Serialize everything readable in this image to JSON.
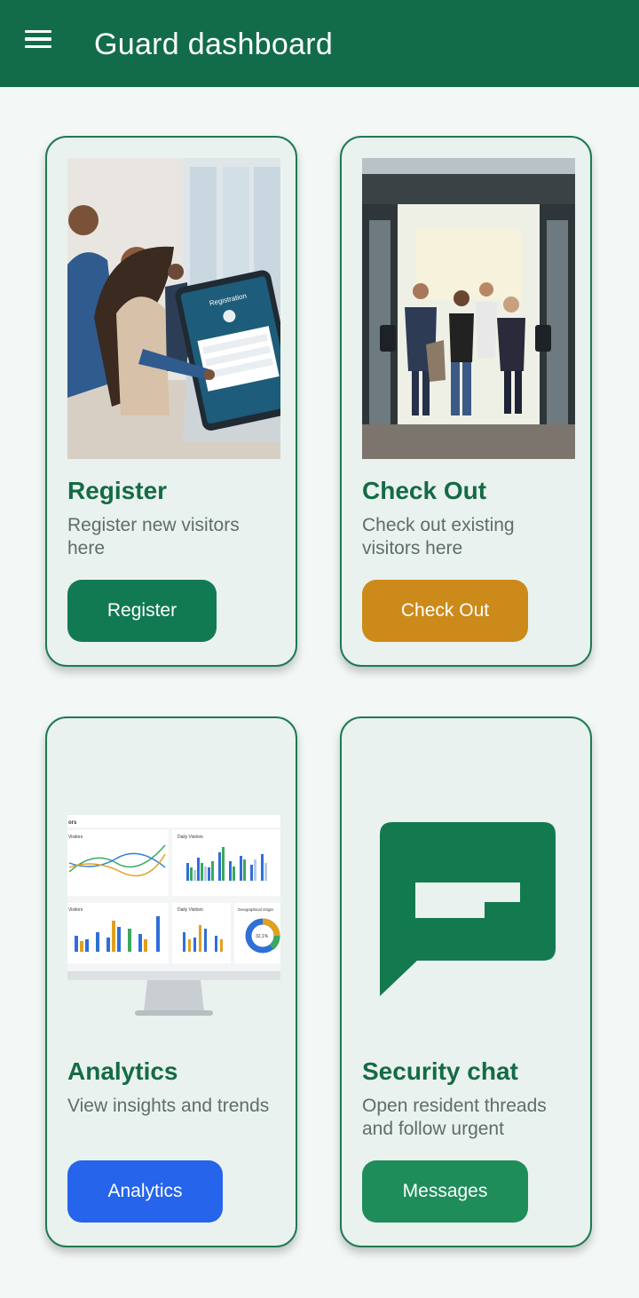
{
  "appbar": {
    "title": "Guard dashboard",
    "menu_icon": "menu-icon"
  },
  "colors": {
    "appbar": "#126c4a",
    "register_button": "#127a52",
    "checkout_button": "#cc8a1a",
    "analytics_button": "#2564eb",
    "messages_button": "#1f8d5a"
  },
  "cards": {
    "register": {
      "title": "Register",
      "description": "Register new visitors here",
      "button": "Register",
      "tablet_heading": "Registration"
    },
    "checkout": {
      "title": "Check Out",
      "description": "Check out existing visitors here",
      "button": "Check Out"
    },
    "analytics": {
      "title": "Analytics",
      "description": "View insights and trends",
      "button": "Analytics",
      "screen_labels": {
        "header": "ors",
        "panel1": "Visitors",
        "panel2": "Daily Visitors",
        "panel3": "Visitors",
        "panel4": "Daily Visitors",
        "panel5": "Geographical Origin",
        "donut_value": "32,1%"
      }
    },
    "chat": {
      "title": "Security chat",
      "description": "Open resident threads and follow urgent",
      "button": "Messages",
      "icon": "chat-icon"
    }
  }
}
